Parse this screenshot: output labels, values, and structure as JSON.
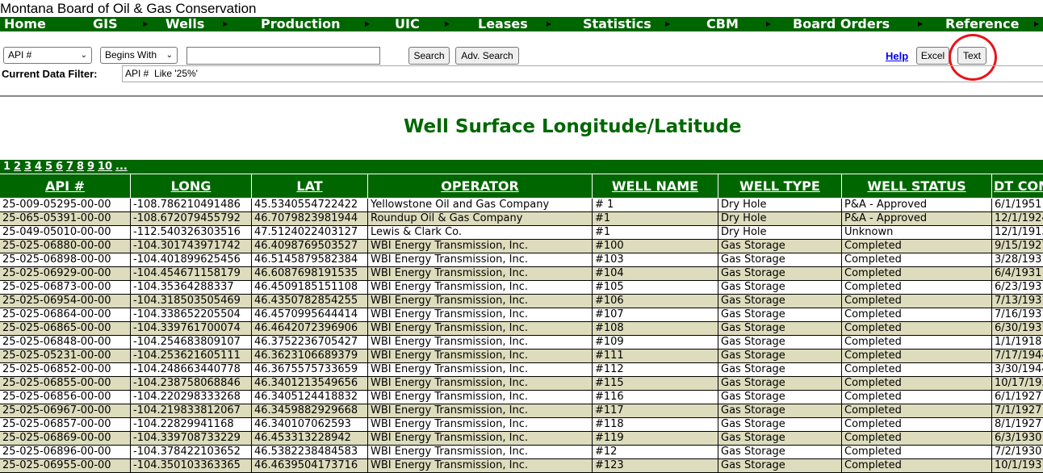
{
  "site": {
    "title": "Montana Board of Oil & Gas Conservation"
  },
  "nav": {
    "items": [
      "Home",
      "GIS",
      "Wells",
      "Production",
      "UIC",
      "Leases",
      "Statistics",
      "CBM",
      "Board Orders",
      "Reference"
    ],
    "arrow_icon": "triangle-right-icon"
  },
  "search": {
    "field_select": "API #",
    "operator_select": "Begins With",
    "value": "",
    "search_label": "Search",
    "adv_search_label": "Adv. Search",
    "help_label": "Help",
    "excel_label": "Excel",
    "text_label": "Text"
  },
  "filter": {
    "label": "Current Data Filter:",
    "value": "API #  Like '25%'"
  },
  "page": {
    "title": "Well Surface Longitude/Latitude"
  },
  "pager": {
    "pages": [
      "1",
      "2",
      "3",
      "4",
      "5",
      "6",
      "7",
      "8",
      "9",
      "10",
      "..."
    ]
  },
  "table": {
    "columns": [
      "API #",
      "LONG",
      "LAT",
      "OPERATOR",
      "WELL NAME",
      "WELL TYPE",
      "WELL STATUS",
      "DT COMP"
    ],
    "rows": [
      [
        "25-009-05295-00-00",
        "-108.786210491486",
        "45.5340554722422",
        "Yellowstone Oil and Gas Company",
        "# 1",
        "Dry Hole",
        "P&A - Approved",
        "6/1/1951"
      ],
      [
        "25-065-05391-00-00",
        "-108.672079455792",
        "46.7079823981944",
        "Roundup Oil & Gas Company",
        "#1",
        "Dry Hole",
        "P&A - Approved",
        "12/1/1924"
      ],
      [
        "25-049-05010-00-00",
        "-112.540326303516",
        "47.5124022403127",
        "Lewis & Clark Co.",
        "#1",
        "Dry Hole",
        "Unknown",
        "12/1/1913"
      ],
      [
        "25-025-06880-00-00",
        "-104.301743971742",
        "46.4098769503527",
        "WBI Energy Transmission, Inc.",
        "#100",
        "Gas Storage",
        "Completed",
        "9/15/1927"
      ],
      [
        "25-025-06898-00-00",
        "-104.401899625456",
        "46.5145879582384",
        "WBI Energy Transmission, Inc.",
        "#103",
        "Gas Storage",
        "Completed",
        "3/28/1931"
      ],
      [
        "25-025-06929-00-00",
        "-104.454671158179",
        "46.6087698191535",
        "WBI Energy Transmission, Inc.",
        "#104",
        "Gas Storage",
        "Completed",
        "6/4/1931"
      ],
      [
        "25-025-06873-00-00",
        "-104.35364288337",
        "46.4509185151108",
        "WBI Energy Transmission, Inc.",
        "#105",
        "Gas Storage",
        "Completed",
        "6/23/1931"
      ],
      [
        "25-025-06954-00-00",
        "-104.318503505469",
        "46.4350782854255",
        "WBI Energy Transmission, Inc.",
        "#106",
        "Gas Storage",
        "Completed",
        "7/13/1931"
      ],
      [
        "25-025-06864-00-00",
        "-104.338652205504",
        "46.4570995644414",
        "WBI Energy Transmission, Inc.",
        "#107",
        "Gas Storage",
        "Completed",
        "7/16/1931"
      ],
      [
        "25-025-06865-00-00",
        "-104.339761700074",
        "46.4642072396906",
        "WBI Energy Transmission, Inc.",
        "#108",
        "Gas Storage",
        "Completed",
        "6/30/1931"
      ],
      [
        "25-025-06848-00-00",
        "-104.254683809107",
        "46.3752236705427",
        "WBI Energy Transmission, Inc.",
        "#109",
        "Gas Storage",
        "Completed",
        "1/1/1918"
      ],
      [
        "25-025-05231-00-00",
        "-104.253621605111",
        "46.3623106689379",
        "WBI Energy Transmission, Inc.",
        "#111",
        "Gas Storage",
        "Completed",
        "7/17/1944"
      ],
      [
        "25-025-06852-00-00",
        "-104.248663440778",
        "46.3675575733659",
        "WBI Energy Transmission, Inc.",
        "#112",
        "Gas Storage",
        "Completed",
        "3/30/1944"
      ],
      [
        "25-025-06855-00-00",
        "-104.238758068846",
        "46.3401213549656",
        "WBI Energy Transmission, Inc.",
        "#115",
        "Gas Storage",
        "Completed",
        "10/17/1931"
      ],
      [
        "25-025-06856-00-00",
        "-104.220298333268",
        "46.3405124418832",
        "WBI Energy Transmission, Inc.",
        "#116",
        "Gas Storage",
        "Completed",
        "6/1/1927"
      ],
      [
        "25-025-06967-00-00",
        "-104.219833812067",
        "46.3459882929668",
        "WBI Energy Transmission, Inc.",
        "#117",
        "Gas Storage",
        "Completed",
        "7/1/1927"
      ],
      [
        "25-025-06857-00-00",
        "-104.22829941168",
        "46.340107062593",
        "WBI Energy Transmission, Inc.",
        "#118",
        "Gas Storage",
        "Completed",
        "8/1/1927"
      ],
      [
        "25-025-06869-00-00",
        "-104.339708733229",
        "46.453313228942",
        "WBI Energy Transmission, Inc.",
        "#119",
        "Gas Storage",
        "Completed",
        "6/3/1930"
      ],
      [
        "25-025-06896-00-00",
        "-104.378422103652",
        "46.5382238484583",
        "WBI Energy Transmission, Inc.",
        "#12",
        "Gas Storage",
        "Completed",
        "7/2/1930"
      ],
      [
        "25-025-06955-00-00",
        "-104.350103363365",
        "46.4639504173716",
        "WBI Energy Transmission, Inc.",
        "#123",
        "Gas Storage",
        "Completed",
        "10/1/1931"
      ]
    ]
  },
  "colors": {
    "green": "#006600",
    "row_alt": "#dddcbd",
    "annotation": "#e8141b",
    "link": "#0000ee"
  }
}
